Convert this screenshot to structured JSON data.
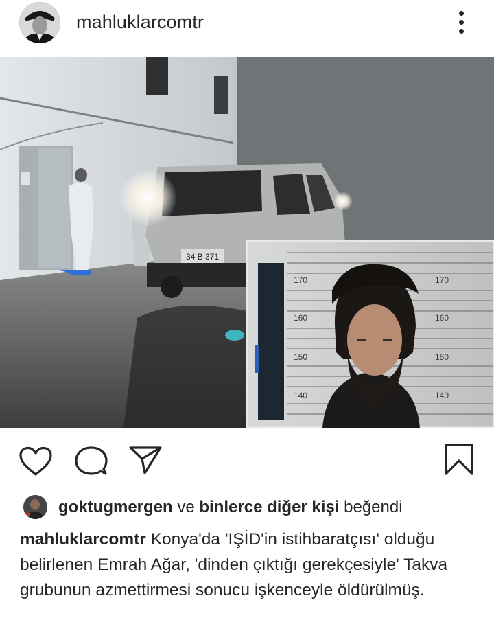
{
  "post": {
    "username": "mahluklarcomtr",
    "photo_description_icons": [
      "more-options-icon"
    ],
    "mugshot_scale": [
      "170",
      "160",
      "150",
      "140"
    ],
    "plate_text": "34 B 371"
  },
  "actions": {
    "icons": [
      "heart-icon",
      "comment-icon",
      "share-icon",
      "bookmark-icon"
    ]
  },
  "likes": {
    "user": "goktugmergen",
    "connector": " ve ",
    "others": "binlerce diğer kişi",
    "suffix": " beğendi"
  },
  "caption": {
    "username": "mahluklarcomtr",
    "text": " Konya'da 'IŞİD'in istihbaratçısı' olduğu belirlenen Emrah Ağar, 'dinden çıktığı gerekçesiyle' Takva grubunun azmettirmesi sonucu işkenceyle öldürülmüş."
  },
  "colors": {
    "text": "#262626",
    "background": "#ffffff"
  }
}
